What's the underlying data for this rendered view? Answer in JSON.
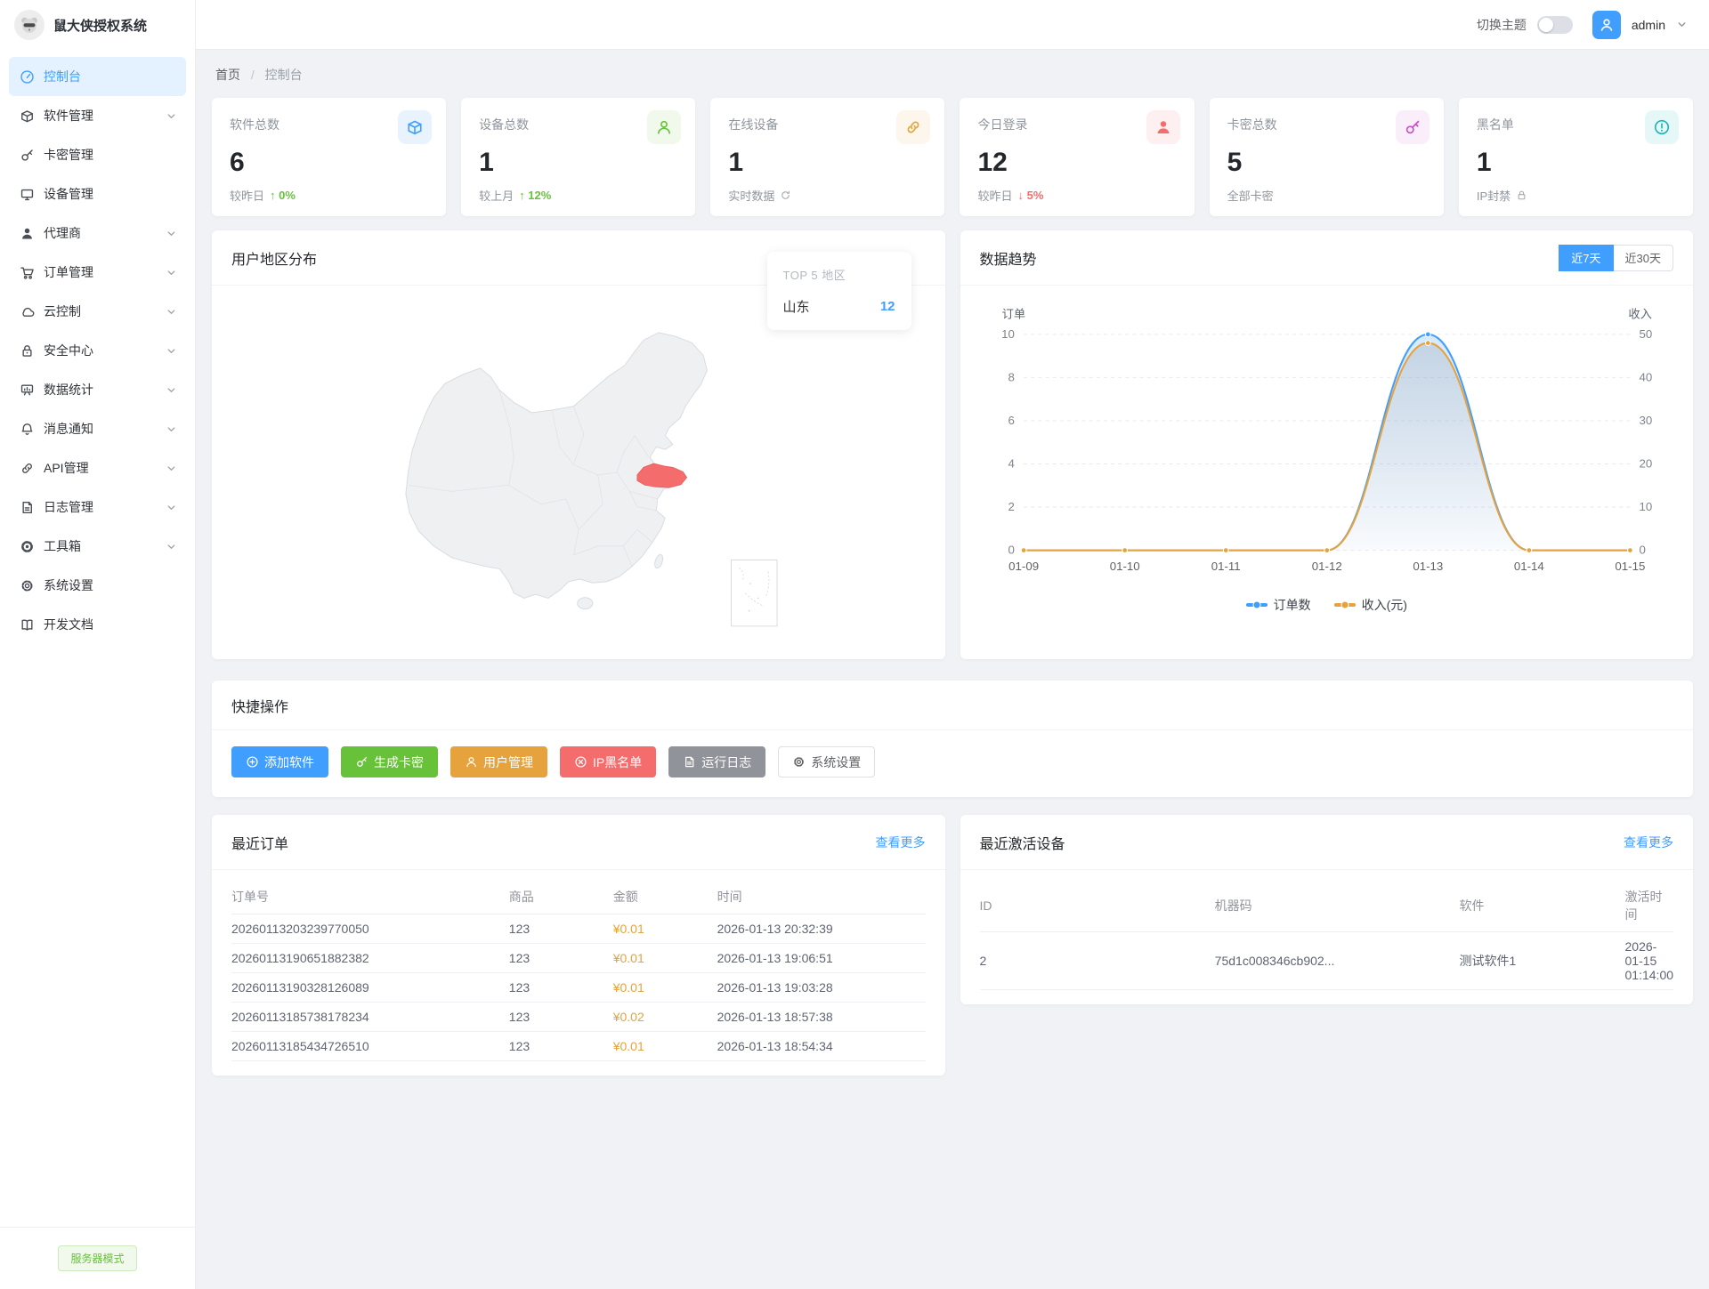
{
  "app": {
    "title": "鼠大侠授权系统"
  },
  "header": {
    "theme_toggle_label": "切换主题",
    "username": "admin"
  },
  "breadcrumb": {
    "home": "首页",
    "separator": "/",
    "current": "控制台"
  },
  "sidebar": {
    "items": [
      {
        "label": "控制台",
        "icon": "dashboard-icon",
        "active": true,
        "expandable": false
      },
      {
        "label": "软件管理",
        "icon": "package-icon",
        "expandable": true
      },
      {
        "label": "卡密管理",
        "icon": "key-icon",
        "expandable": false
      },
      {
        "label": "设备管理",
        "icon": "monitor-icon",
        "expandable": false
      },
      {
        "label": "代理商",
        "icon": "agent-icon",
        "expandable": true
      },
      {
        "label": "订单管理",
        "icon": "cart-icon",
        "expandable": true
      },
      {
        "label": "云控制",
        "icon": "cloud-icon",
        "expandable": true
      },
      {
        "label": "安全中心",
        "icon": "lock-icon",
        "expandable": true
      },
      {
        "label": "数据统计",
        "icon": "stats-icon",
        "expandable": true
      },
      {
        "label": "消息通知",
        "icon": "bell-icon",
        "expandable": true
      },
      {
        "label": "API管理",
        "icon": "api-icon",
        "expandable": true
      },
      {
        "label": "日志管理",
        "icon": "log-icon",
        "expandable": true
      },
      {
        "label": "工具箱",
        "icon": "toolbox-icon",
        "expandable": true
      },
      {
        "label": "系统设置",
        "icon": "settings-icon",
        "expandable": false
      },
      {
        "label": "开发文档",
        "icon": "docs-icon",
        "expandable": false
      }
    ],
    "footer_badge": "服务器模式"
  },
  "stats": [
    {
      "label": "软件总数",
      "value": "6",
      "sub": "较昨日",
      "delta_text": "↑ 0%",
      "delta_color": "#67c23a",
      "icon": "package-icon",
      "icon_color": "#409eff",
      "icon_bg": "#e8f3fe"
    },
    {
      "label": "设备总数",
      "value": "1",
      "sub": "较上月",
      "delta_text": "↑ 12%",
      "delta_color": "#67c23a",
      "icon": "user-outline-icon",
      "icon_color": "#67c23a",
      "icon_bg": "#f0f9eb"
    },
    {
      "label": "在线设备",
      "value": "1",
      "sub": "实时数据",
      "sub_icon": "refresh-icon",
      "icon": "link-icon",
      "icon_color": "#e6a23c",
      "icon_bg": "#fdf6ec"
    },
    {
      "label": "今日登录",
      "value": "12",
      "sub": "较昨日",
      "delta_text": "↓ 5%",
      "delta_color": "#f56c6c",
      "icon": "user-filled-icon",
      "icon_color": "#f56c6c",
      "icon_bg": "#fef0f0"
    },
    {
      "label": "卡密总数",
      "value": "5",
      "sub": "全部卡密",
      "icon": "key-icon",
      "icon_color": "#c44ec4",
      "icon_bg": "#faeefa"
    },
    {
      "label": "黑名单",
      "value": "1",
      "sub": "IP封禁",
      "sub_icon": "small-lock-icon",
      "icon": "warning-icon",
      "icon_color": "#1bb6b6",
      "icon_bg": "#e6f7f7"
    }
  ],
  "map_panel": {
    "title": "用户地区分布",
    "top_regions": {
      "title": "TOP 5 地区",
      "rows": [
        {
          "name": "山东",
          "value": "12"
        }
      ]
    }
  },
  "trend_panel": {
    "title": "数据趋势",
    "range_buttons": [
      {
        "label": "近7天",
        "active": true
      },
      {
        "label": "近30天",
        "active": false
      }
    ]
  },
  "chart_data": {
    "type": "line",
    "smooth": true,
    "x": [
      "01-09",
      "01-10",
      "01-11",
      "01-12",
      "01-13",
      "01-14",
      "01-15"
    ],
    "series": [
      {
        "name": "订单数",
        "axis": "left",
        "color": "#409eff",
        "values": [
          0,
          0,
          0,
          0,
          10,
          0,
          0
        ]
      },
      {
        "name": "收入(元)",
        "axis": "right",
        "color": "#e6a23c",
        "values": [
          0,
          0,
          0,
          0,
          48,
          0,
          0
        ]
      }
    ],
    "left_axis": {
      "label": "订单",
      "min": 0,
      "max": 10,
      "ticks": [
        0,
        2,
        4,
        6,
        8,
        10
      ]
    },
    "right_axis": {
      "label": "收入",
      "min": 0,
      "max": 50,
      "ticks": [
        0,
        10,
        20,
        30,
        40,
        50
      ]
    },
    "legend": [
      "订单数",
      "收入(元)"
    ],
    "legend_position": "bottom",
    "grid": true
  },
  "quick_actions": {
    "title": "快捷操作",
    "buttons": [
      {
        "label": "添加软件",
        "icon": "plus-circle-icon",
        "bg": "#409eff",
        "color": "#ffffff",
        "border": "#409eff"
      },
      {
        "label": "生成卡密",
        "icon": "key-icon",
        "bg": "#67c23a",
        "color": "#ffffff",
        "border": "#67c23a"
      },
      {
        "label": "用户管理",
        "icon": "user-outline-icon",
        "bg": "#e6a23c",
        "color": "#ffffff",
        "border": "#e6a23c"
      },
      {
        "label": "IP黑名单",
        "icon": "ban-icon",
        "bg": "#f56c6c",
        "color": "#ffffff",
        "border": "#f56c6c"
      },
      {
        "label": "运行日志",
        "icon": "log-icon",
        "bg": "#909399",
        "color": "#ffffff",
        "border": "#909399"
      },
      {
        "label": "系统设置",
        "icon": "settings-icon",
        "bg": "#ffffff",
        "color": "#606266",
        "border": "#dcdfe6"
      }
    ]
  },
  "recent_orders": {
    "title": "最近订单",
    "more_label": "查看更多",
    "columns": [
      "订单号",
      "商品",
      "金额",
      "时间"
    ],
    "rows": [
      [
        "20260113203239770050",
        "123",
        "¥0.01",
        "2026-01-13 20:32:39"
      ],
      [
        "20260113190651882382",
        "123",
        "¥0.01",
        "2026-01-13 19:06:51"
      ],
      [
        "20260113190328126089",
        "123",
        "¥0.01",
        "2026-01-13 19:03:28"
      ],
      [
        "20260113185738178234",
        "123",
        "¥0.02",
        "2026-01-13 18:57:38"
      ],
      [
        "20260113185434726510",
        "123",
        "¥0.01",
        "2026-01-13 18:54:34"
      ]
    ]
  },
  "recent_devices": {
    "title": "最近激活设备",
    "more_label": "查看更多",
    "columns": [
      "ID",
      "机器码",
      "软件",
      "激活时间"
    ],
    "rows": [
      [
        "2",
        "75d1c008346cb902...",
        "测试软件1",
        "2026-01-15 01:14:00"
      ]
    ]
  }
}
